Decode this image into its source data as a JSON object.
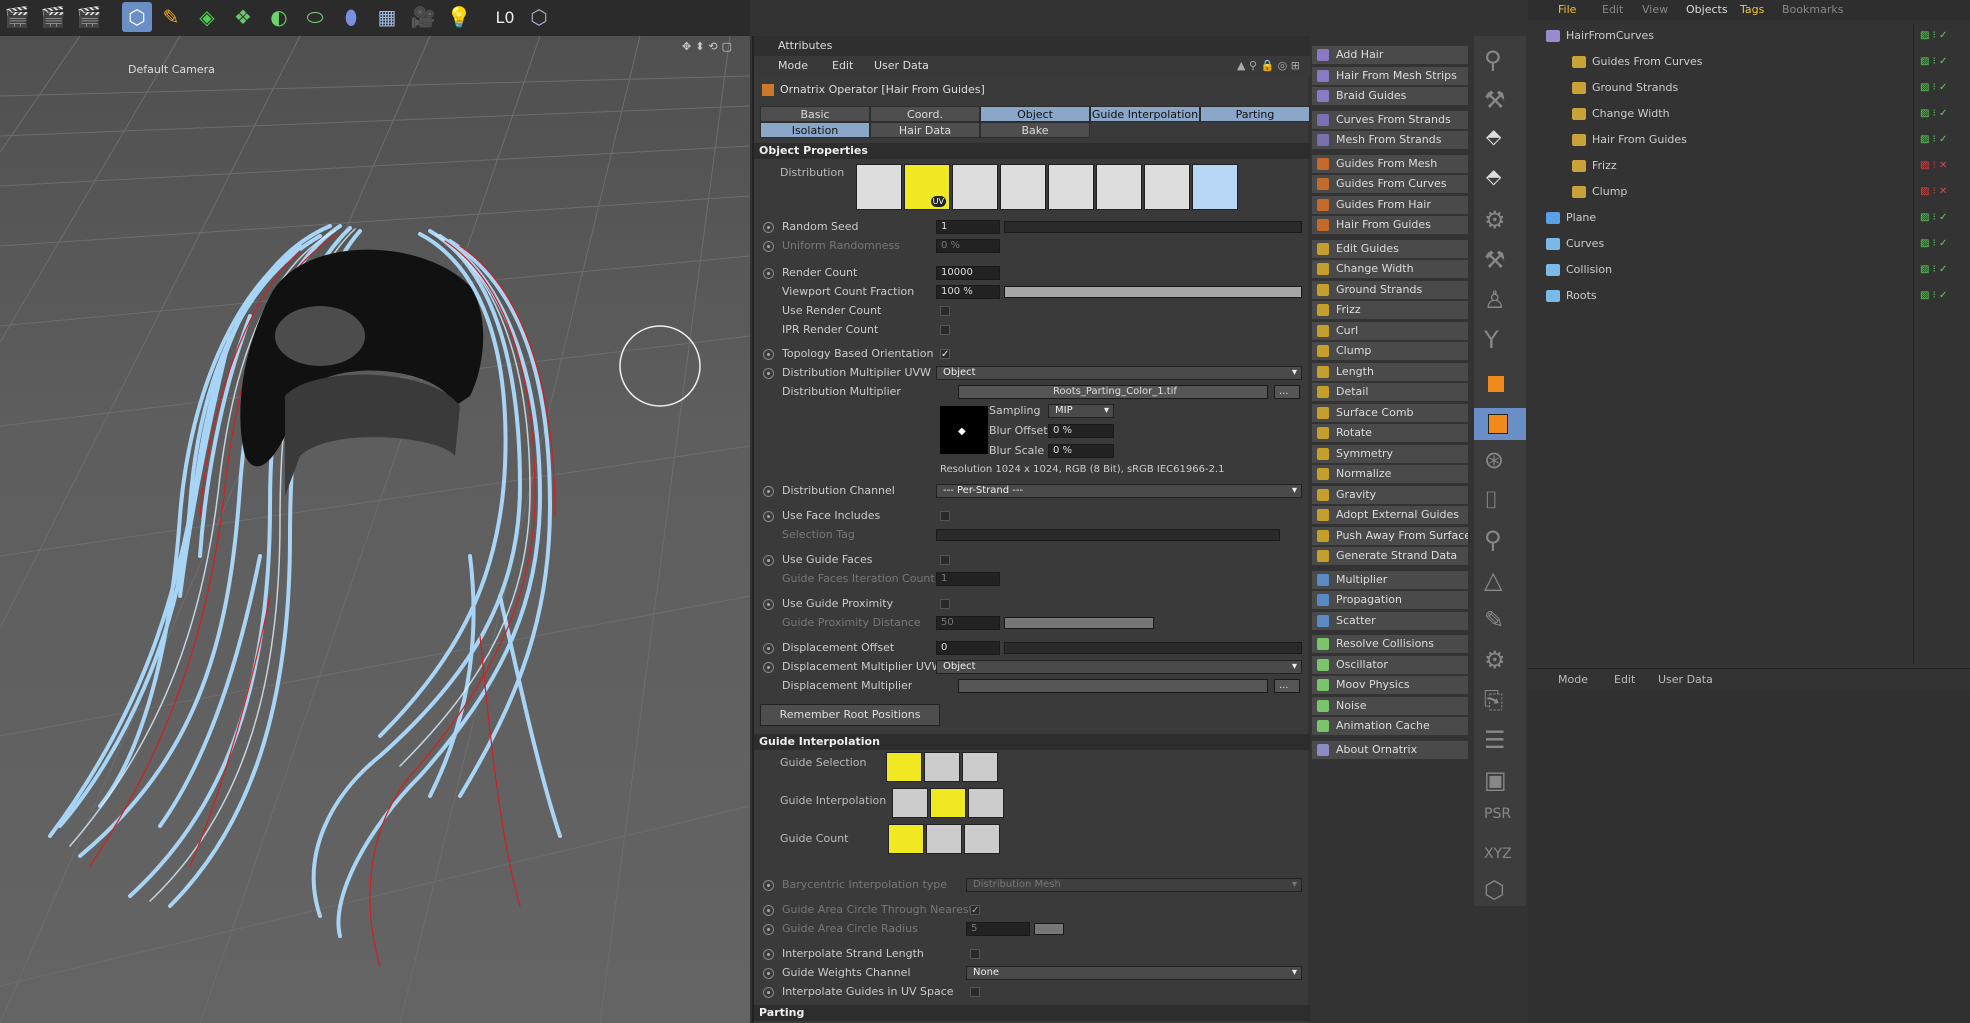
{
  "viewport": {
    "camera": "Default Camera"
  },
  "attributes": {
    "title": "Attributes",
    "menu": [
      "Mode",
      "Edit",
      "User Data"
    ],
    "object_title": "Ornatrix Operator [Hair From Guides]",
    "tabs_row1": [
      "Basic",
      "Coord.",
      "Object",
      "Guide Interpolation",
      "Parting"
    ],
    "tabs_row2": [
      "Isolation",
      "Hair Data",
      "Bake"
    ],
    "section_object": "Object Properties",
    "distribution_label": "Distribution",
    "distribution_badge": "UV",
    "random_seed": {
      "label": "Random Seed",
      "value": "1"
    },
    "uniform_randomness": {
      "label": "Uniform Randomness",
      "value": "0 %"
    },
    "render_count": {
      "label": "Render Count",
      "value": "10000"
    },
    "viewport_count": {
      "label": "Viewport Count Fraction",
      "value": "100 %"
    },
    "use_render_count": "Use Render Count",
    "ipr_render_count": "IPR Render Count",
    "topology": "Topology Based Orientation",
    "dist_mult_uvw": {
      "label": "Distribution Multiplier UVW",
      "value": "Object"
    },
    "dist_mult": {
      "label": "Distribution Multiplier",
      "value": "Roots_Parting_Color_1.tif",
      "browse": "..."
    },
    "sampling": {
      "label": "Sampling",
      "value": "MIP"
    },
    "blur_offset": {
      "label": "Blur Offset",
      "value": "0 %"
    },
    "blur_scale": {
      "label": "Blur Scale",
      "value": "0 %"
    },
    "resolution": "Resolution 1024 x 1024, RGB (8 Bit), sRGB IEC61966-2.1",
    "dist_channel": {
      "label": "Distribution Channel",
      "value": "--- Per-Strand ---"
    },
    "use_face_includes": "Use Face Includes",
    "selection_tag": "Selection Tag",
    "use_guide_faces": "Use Guide Faces",
    "guide_faces_iter": {
      "label": "Guide Faces Iteration Count",
      "value": "1"
    },
    "use_guide_prox": "Use Guide Proximity",
    "guide_prox_dist": {
      "label": "Guide Proximity Distance",
      "value": "50"
    },
    "disp_offset": {
      "label": "Displacement Offset",
      "value": "0"
    },
    "disp_mult_uvw": {
      "label": "Displacement Multiplier UVW",
      "value": "Object"
    },
    "disp_mult": {
      "label": "Displacement Multiplier",
      "browse": "..."
    },
    "remember_btn": "Remember Root Positions",
    "section_guide": "Guide Interpolation",
    "guide_selection": "Guide Selection",
    "guide_interpolation": "Guide Interpolation",
    "guide_count": "Guide Count",
    "bary_type": {
      "label": "Barycentric Interpolation type",
      "value": "Distribution Mesh"
    },
    "guide_area_circle": "Guide Area Circle Through Nearest",
    "guide_area_radius": {
      "label": "Guide Area Circle Radius",
      "value": "5"
    },
    "interp_strand_len": "Interpolate Strand Length",
    "guide_weights": {
      "label": "Guide Weights Channel",
      "value": "None"
    },
    "interp_uv": "Interpolate Guides in UV Space",
    "section_parting": "Parting"
  },
  "commands": [
    "Add Hair",
    "Hair From Mesh Strips",
    "Braid Guides",
    "Curves From Strands",
    "Mesh From Strands",
    "Guides From Mesh",
    "Guides From Curves",
    "Guides From Hair",
    "Hair From Guides",
    "Edit Guides",
    "Change Width",
    "Ground Strands",
    "Frizz",
    "Curl",
    "Clump",
    "Length",
    "Detail",
    "Surface Comb",
    "Rotate",
    "Symmetry",
    "Normalize",
    "Gravity",
    "Adopt External Guides",
    "Push Away From Surface",
    "Generate Strand Data",
    "Multiplier",
    "Propagation",
    "Scatter",
    "Resolve Collisions",
    "Oscillator",
    "Moov Physics",
    "Noise",
    "Animation Cache",
    "About Ornatrix"
  ],
  "object_manager": {
    "menu": [
      "File",
      "Edit",
      "View",
      "Objects",
      "Tags",
      "Bookmarks"
    ],
    "items": [
      "HairFromCurves",
      "Guides From Curves",
      "Ground Strands",
      "Change Width",
      "Hair From Guides",
      "Frizz",
      "Clump",
      "Plane",
      "Curves",
      "Collision",
      "Roots"
    ]
  },
  "attr2": {
    "menu": [
      "Mode",
      "Edit",
      "User Data"
    ]
  },
  "colors": {
    "accent": "#8aa7c9",
    "highlight": "#f0e820",
    "hair": "#a8d4f5",
    "guide": "#d21f1f"
  }
}
